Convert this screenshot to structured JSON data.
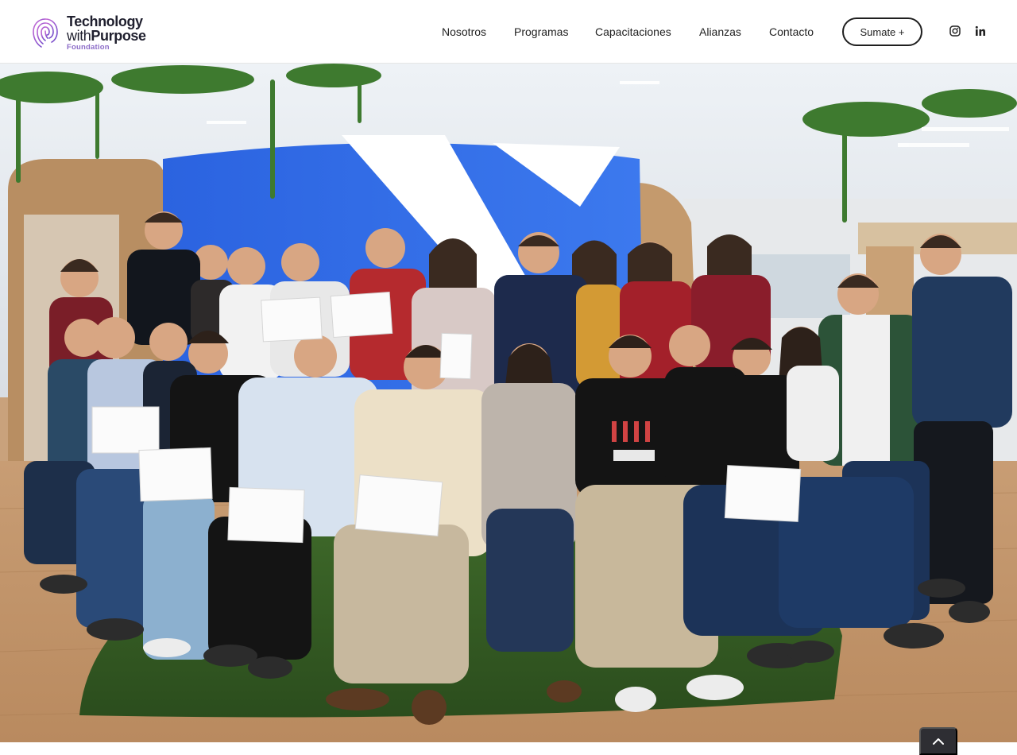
{
  "brand": {
    "line1": "Technology",
    "line2_light": "with",
    "line2_bold": "Purpose",
    "line3": "Foundation",
    "accent_color": "#8c6cc8"
  },
  "nav": {
    "items": [
      {
        "label": "Nosotros"
      },
      {
        "label": "Programas"
      },
      {
        "label": "Capacitaciones"
      },
      {
        "label": "Alianzas"
      },
      {
        "label": "Contacto"
      }
    ],
    "cta_label": "Sumate +"
  },
  "social": {
    "instagram_icon": "instagram-icon",
    "linkedin_icon": "linkedin-icon"
  },
  "hero": {
    "image_kind": "group-photo"
  },
  "scroll_top": {
    "icon": "chevron-up-icon"
  }
}
